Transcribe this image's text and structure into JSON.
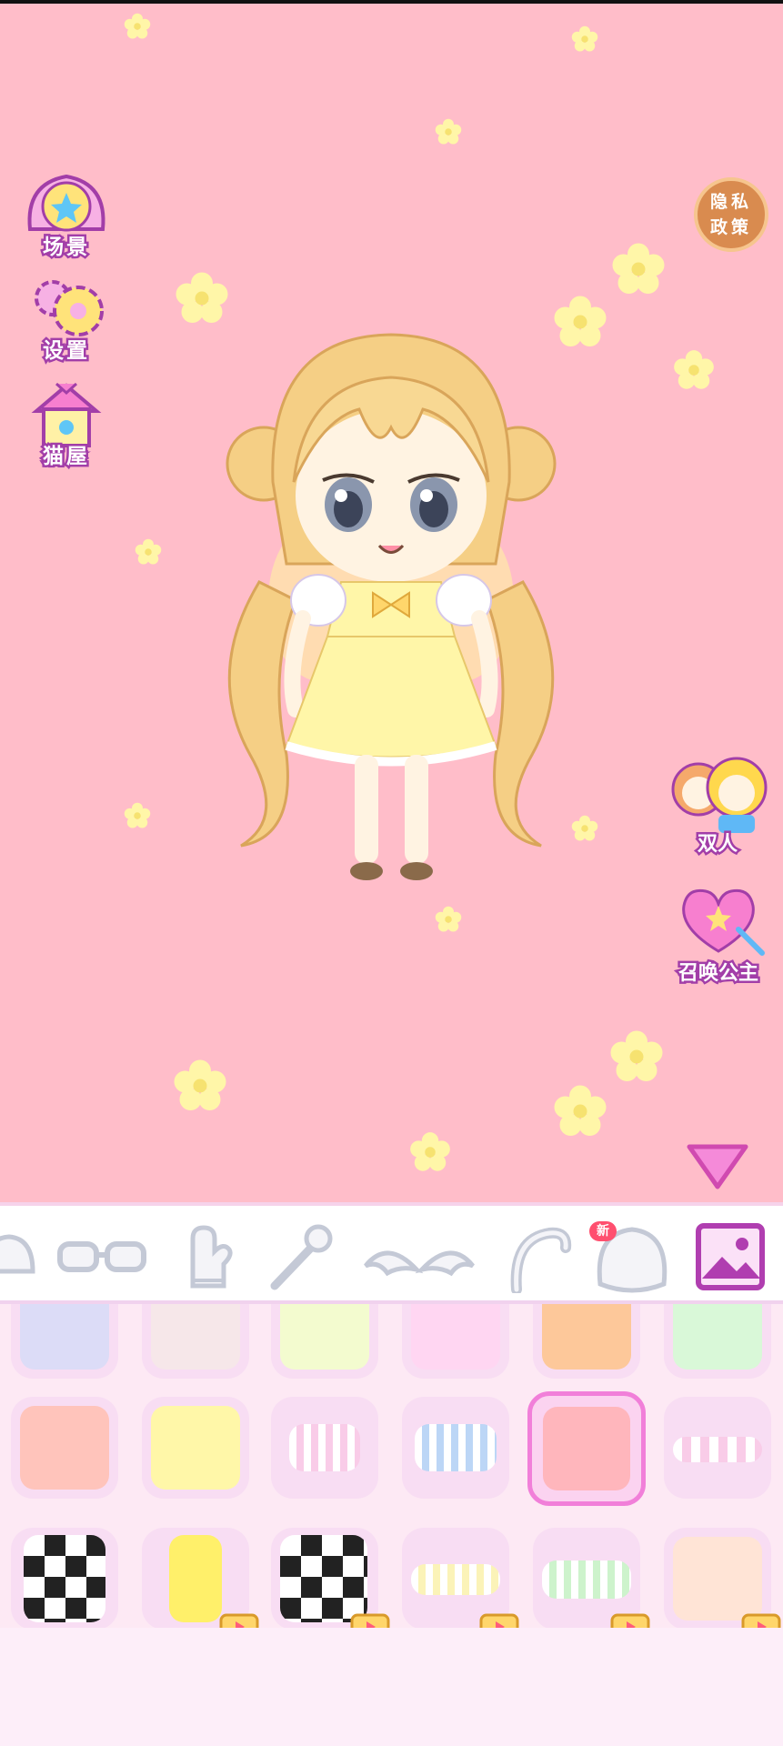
{
  "left_menu": {
    "scene_label": "场景",
    "settings_label": "设置",
    "cat_house_label": "猫屋"
  },
  "right_menu": {
    "privacy_label": "隐私政策",
    "duo_label": "双人",
    "summon_label": "召唤公主"
  },
  "toolbar": {
    "new_badge": "新",
    "tools": [
      "hat-icon",
      "glasses-icon",
      "glove-icon",
      "wand-icon",
      "wings-icon",
      "tail-icon",
      "pet-icon",
      "background-icon"
    ]
  },
  "colors": {
    "stage_bg": "#ffbdc9",
    "panel_bg": "#fde9f4",
    "accent": "#f17fd9",
    "label_stroke": "#a23ea8"
  }
}
